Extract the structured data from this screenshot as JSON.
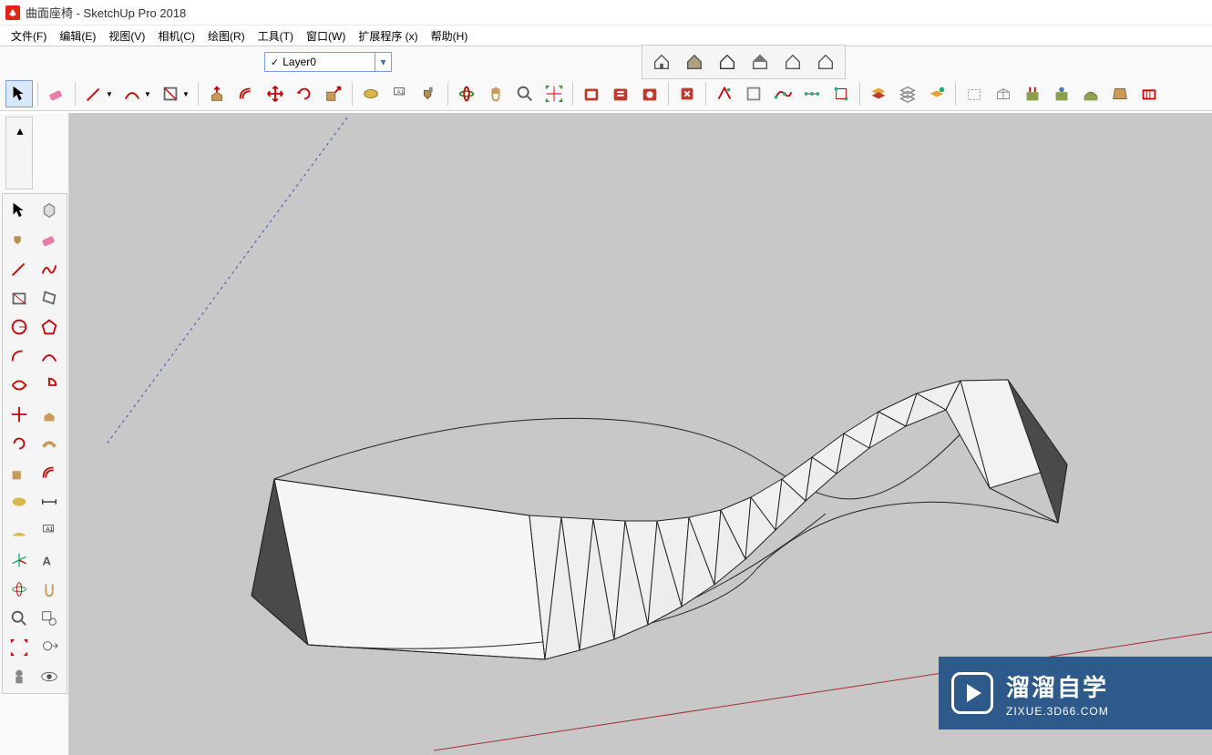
{
  "title": "曲面座椅 - SketchUp Pro 2018",
  "menus": [
    "文件(F)",
    "编辑(E)",
    "视图(V)",
    "相机(C)",
    "绘图(R)",
    "工具(T)",
    "窗口(W)",
    "扩展程序 (x)",
    "帮助(H)"
  ],
  "layer": {
    "selected": "Layer0"
  },
  "watermark": {
    "main": "溜溜自学",
    "sub": "ZIXUE.3D66.COM"
  }
}
